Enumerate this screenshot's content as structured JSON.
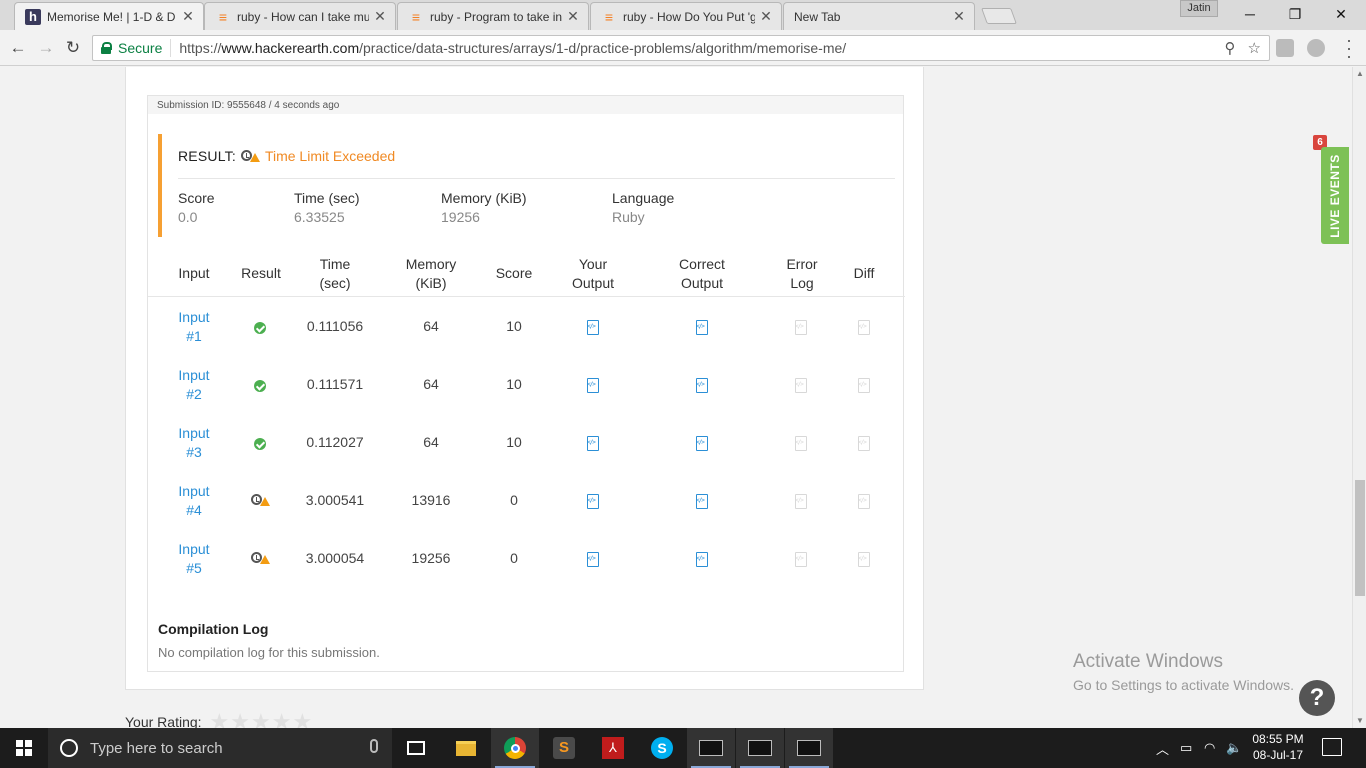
{
  "browser": {
    "tabs": [
      {
        "title": "Memorise Me! | 1-D & D",
        "favicon": "hackerearth-icon",
        "active": true
      },
      {
        "title": "ruby - How can I take mu",
        "favicon": "stackoverflow-icon",
        "active": false
      },
      {
        "title": "ruby - Program to take in",
        "favicon": "stackoverflow-icon",
        "active": false
      },
      {
        "title": "ruby - How Do You Put 'g",
        "favicon": "stackoverflow-icon",
        "active": false
      },
      {
        "title": "New Tab",
        "favicon": "",
        "active": false
      }
    ],
    "user": "Jatin",
    "secure_label": "Secure",
    "url_scheme": "https://",
    "url_host": "www.hackerearth.com",
    "url_path": "/practice/data-structures/arrays/1-d/practice-problems/algorithm/memorise-me/"
  },
  "submission": {
    "header": "Submission ID: 9555648 / 4 seconds ago",
    "result_label": "RESULT:",
    "result_value": "Time Limit Exceeded",
    "stats": [
      {
        "label": "Score",
        "value": "0.0"
      },
      {
        "label": "Time (sec)",
        "value": "6.33525"
      },
      {
        "label": "Memory (KiB)",
        "value": "19256"
      },
      {
        "label": "Language",
        "value": "Ruby"
      }
    ],
    "columns": [
      {
        "line1": "Input",
        "line2": ""
      },
      {
        "line1": "Result",
        "line2": ""
      },
      {
        "line1": "Time",
        "line2": "(sec)"
      },
      {
        "line1": "Memory",
        "line2": "(KiB)"
      },
      {
        "line1": "Score",
        "line2": ""
      },
      {
        "line1": "Your",
        "line2": "Output"
      },
      {
        "line1": "Correct",
        "line2": "Output"
      },
      {
        "line1": "Error",
        "line2": "Log"
      },
      {
        "line1": "Diff",
        "line2": ""
      }
    ],
    "rows": [
      {
        "input_line1": "Input",
        "input_line2": "#1",
        "status": "accepted",
        "time": "0.111056",
        "memory": "64",
        "score": "10"
      },
      {
        "input_line1": "Input",
        "input_line2": "#2",
        "status": "accepted",
        "time": "0.111571",
        "memory": "64",
        "score": "10"
      },
      {
        "input_line1": "Input",
        "input_line2": "#3",
        "status": "accepted",
        "time": "0.112027",
        "memory": "64",
        "score": "10"
      },
      {
        "input_line1": "Input",
        "input_line2": "#4",
        "status": "time-limit-exceeded",
        "time": "3.000541",
        "memory": "13916",
        "score": "0"
      },
      {
        "input_line1": "Input",
        "input_line2": "#5",
        "status": "time-limit-exceeded",
        "time": "3.000054",
        "memory": "19256",
        "score": "0"
      }
    ],
    "compilation_title": "Compilation Log",
    "compilation_text": "No compilation log for this submission."
  },
  "rating_label": "Your Rating:",
  "rating_stars": 0,
  "live_events": {
    "label": "LIVE EVENTS",
    "count": "6"
  },
  "activate_windows": {
    "line1": "Activate Windows",
    "line2": "Go to Settings to activate Windows."
  },
  "help_label": "?",
  "taskbar": {
    "search_placeholder": "Type here to search",
    "time": "08:55 PM",
    "date": "08-Jul-17"
  },
  "colors": {
    "accent_orange": "#f6a033",
    "tle_text": "#f08a24",
    "link_blue": "#2b8fd6",
    "ok_green": "#4caf50",
    "live_green": "#7dc156",
    "badge_red": "#d9453d"
  }
}
